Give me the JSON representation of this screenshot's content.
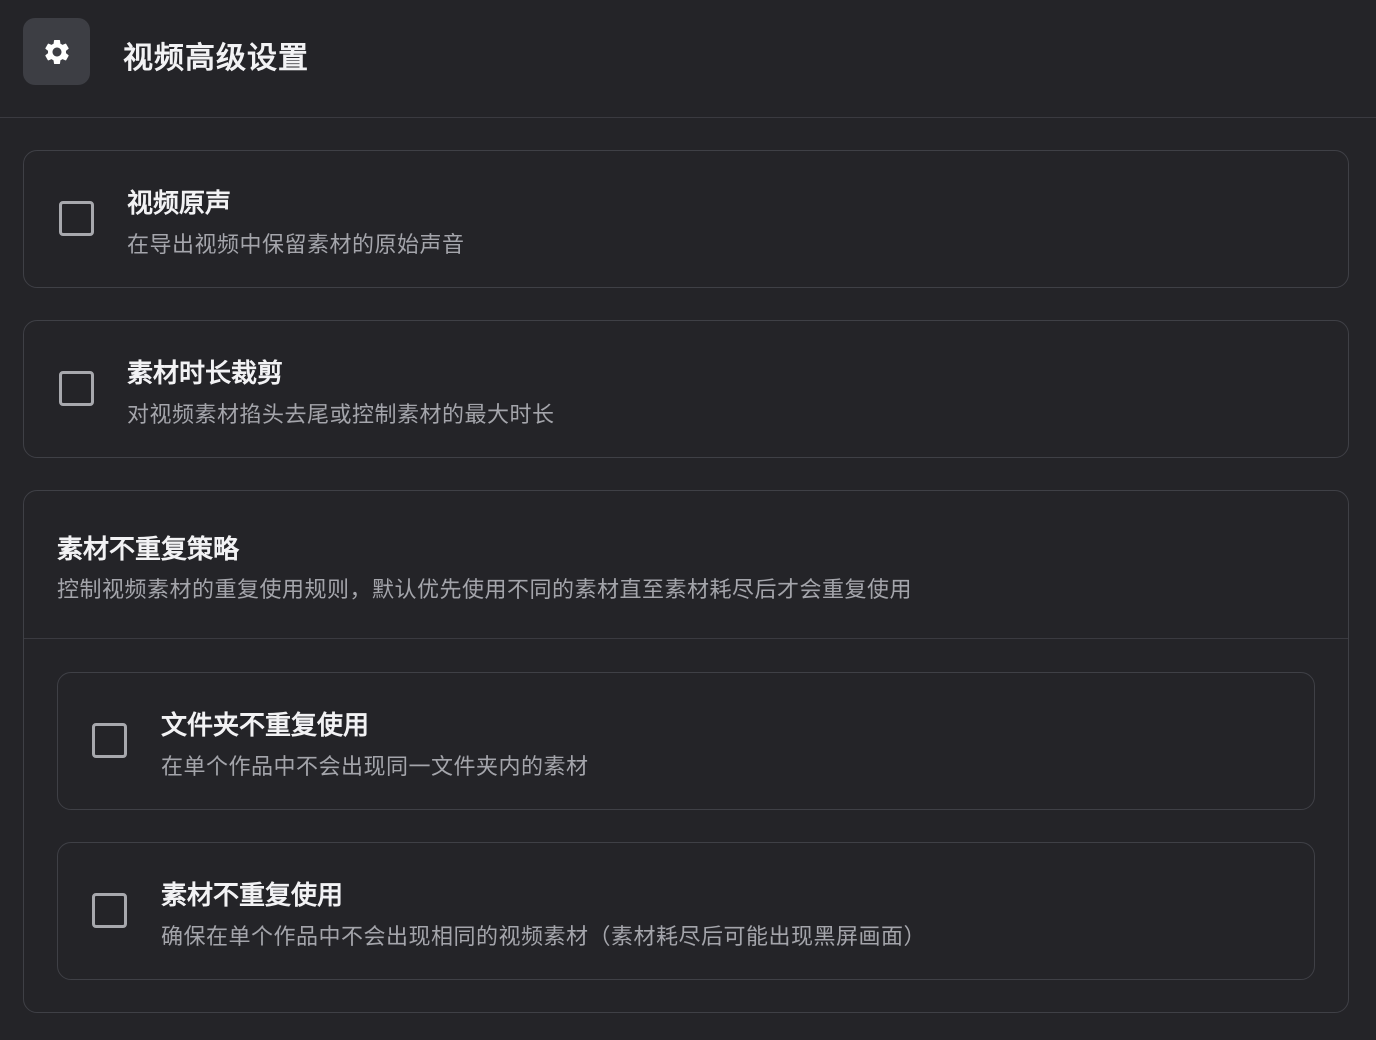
{
  "header": {
    "icon": "gear-icon",
    "title": "视频高级设置"
  },
  "options": {
    "original_audio": {
      "title": "视频原声",
      "desc": "在导出视频中保留素材的原始声音",
      "checked": false
    },
    "trim": {
      "title": "素材时长裁剪",
      "desc": "对视频素材掐头去尾或控制素材的最大时长",
      "checked": false
    }
  },
  "no_repeat": {
    "title": "素材不重复策略",
    "desc": "控制视频素材的重复使用规则，默认优先使用不同的素材直至素材耗尽后才会重复使用",
    "folder": {
      "title": "文件夹不重复使用",
      "desc": "在单个作品中不会出现同一文件夹内的素材",
      "checked": false
    },
    "material": {
      "title": "素材不重复使用",
      "desc": "确保在单个作品中不会出现相同的视频素材（素材耗尽后可能出现黑屏画面）",
      "checked": false
    }
  },
  "colors": {
    "background": "#242428",
    "border": "#3f4046",
    "icon_bg": "#3d3e44",
    "text_primary": "#f2f2f4",
    "text_secondary": "#a4a5ab"
  }
}
